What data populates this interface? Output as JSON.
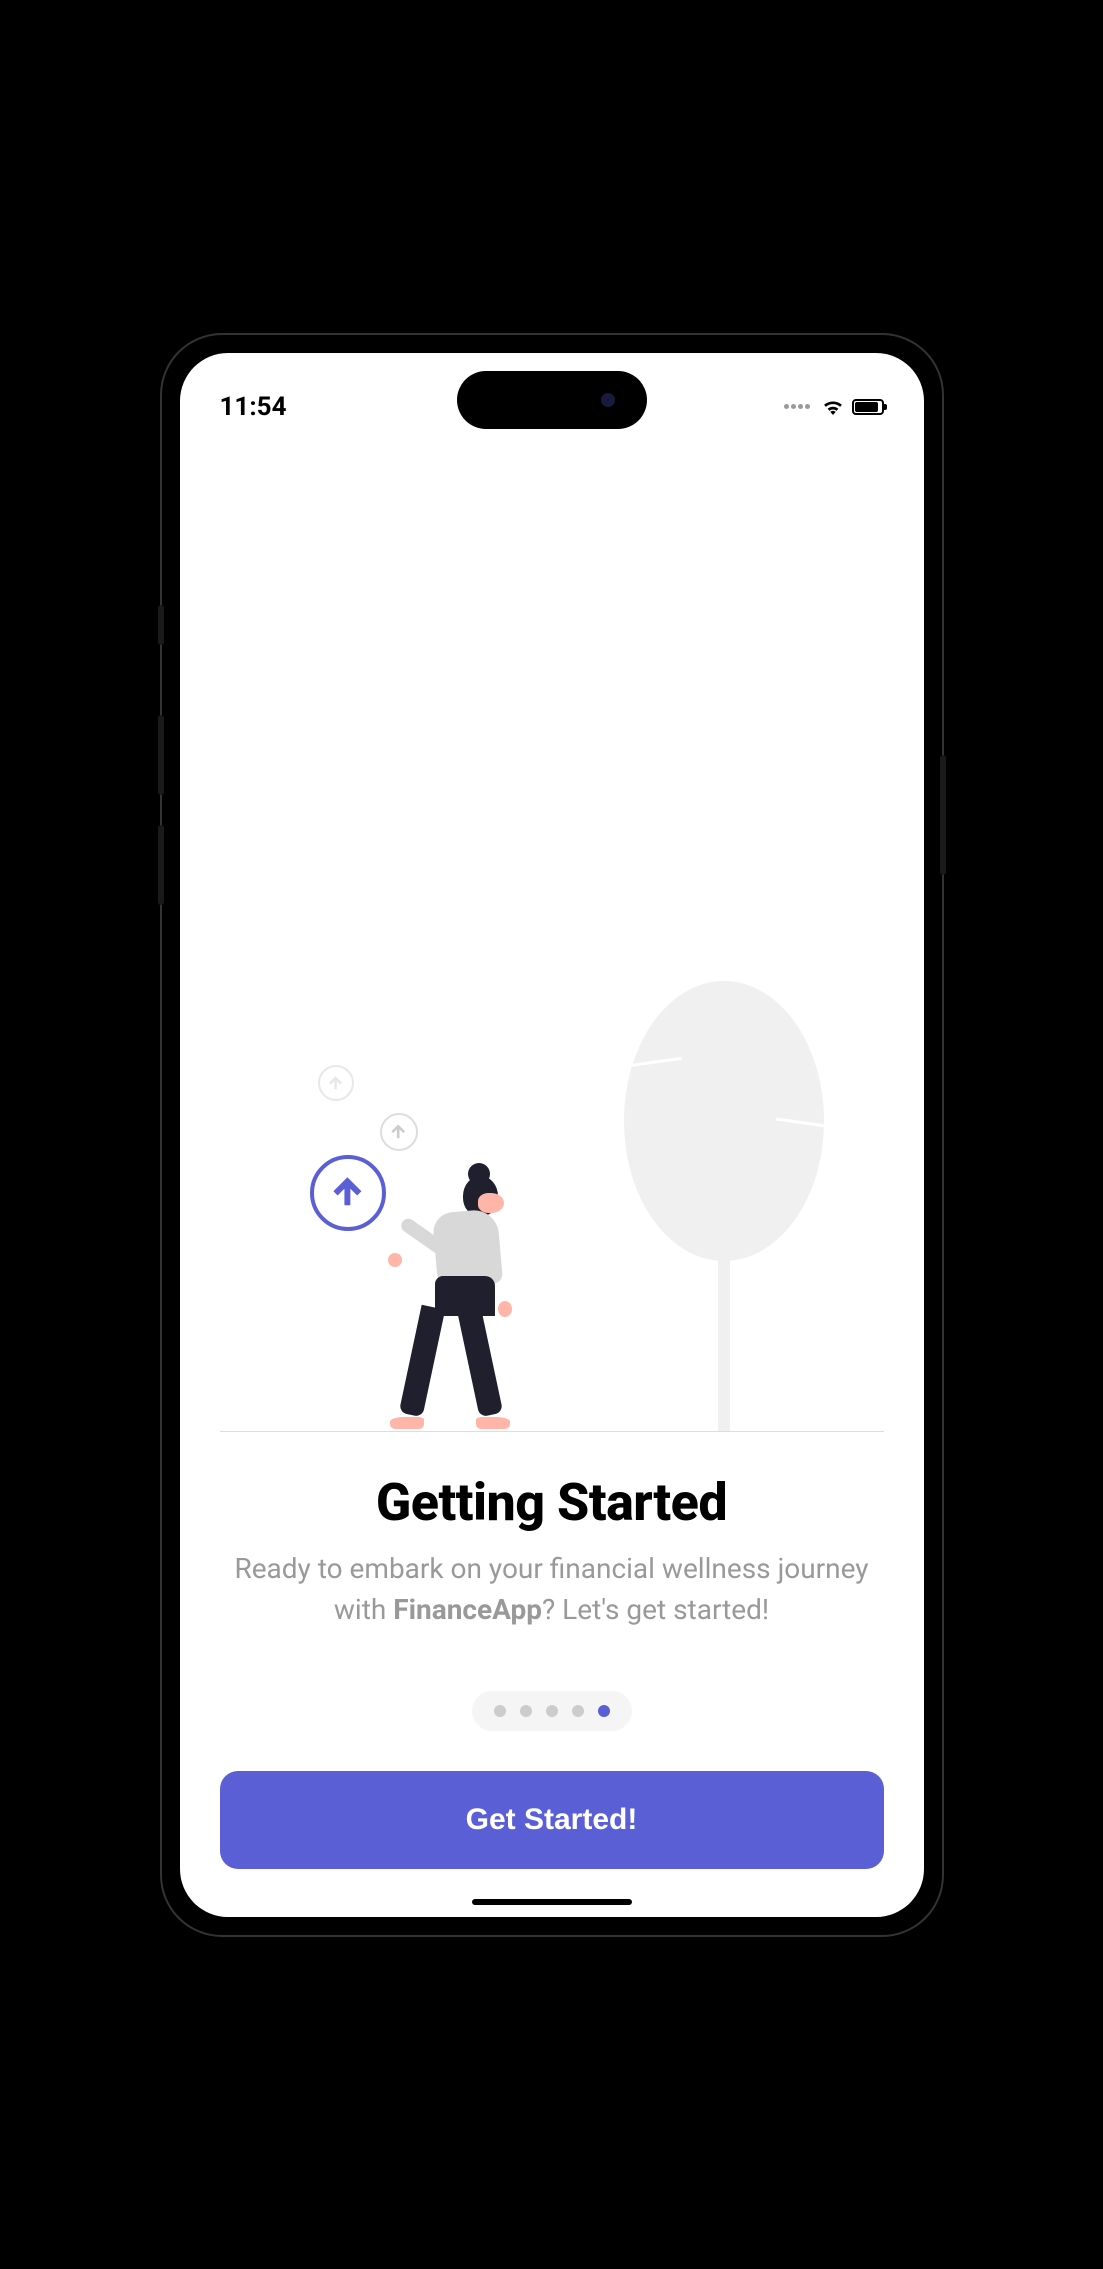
{
  "status_bar": {
    "time": "11:54"
  },
  "onboarding": {
    "heading": "Getting Started",
    "subtitle_before": "Ready to embark on your financial wellness journey with ",
    "subtitle_brand": "FinanceApp",
    "subtitle_after": "? Let's get started!"
  },
  "pagination": {
    "total": 5,
    "active_index": 4
  },
  "cta": {
    "label": "Get Started!"
  },
  "colors": {
    "accent": "#5b5fd6",
    "text_muted": "#999",
    "illustration_gray": "#f0f0f0"
  }
}
